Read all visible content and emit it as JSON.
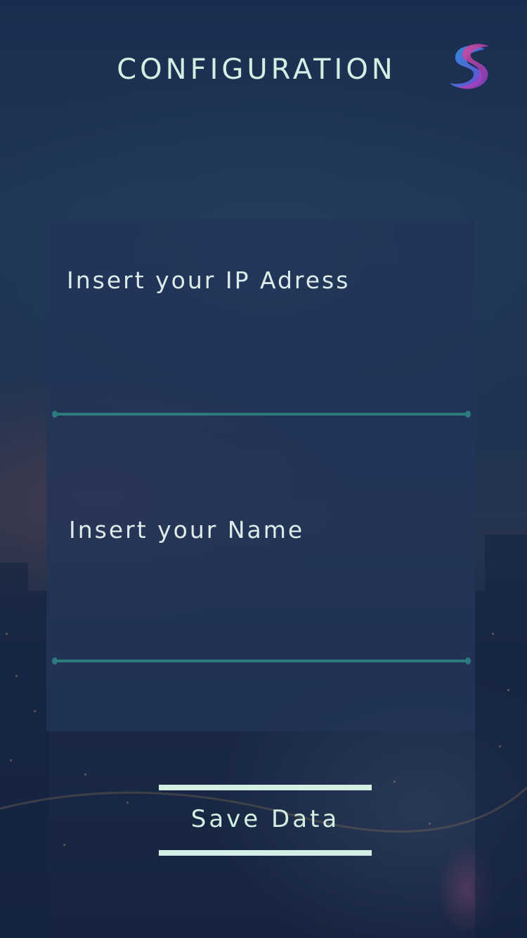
{
  "header": {
    "title": "CONFIGURATION",
    "logo_icon": "swirl-s-logo-icon"
  },
  "form": {
    "ip_label": "Insert your IP Adress",
    "ip_value": "",
    "name_label": "Insert your Name",
    "name_value": ""
  },
  "actions": {
    "save_label": "Save Data"
  },
  "colors": {
    "accent_text": "#d3eee2",
    "underline": "#2b7a7e",
    "panel": "#223458",
    "logo_blue": "#2f8bd8",
    "logo_pink": "#e2458c",
    "logo_purple": "#6a4bd1"
  }
}
